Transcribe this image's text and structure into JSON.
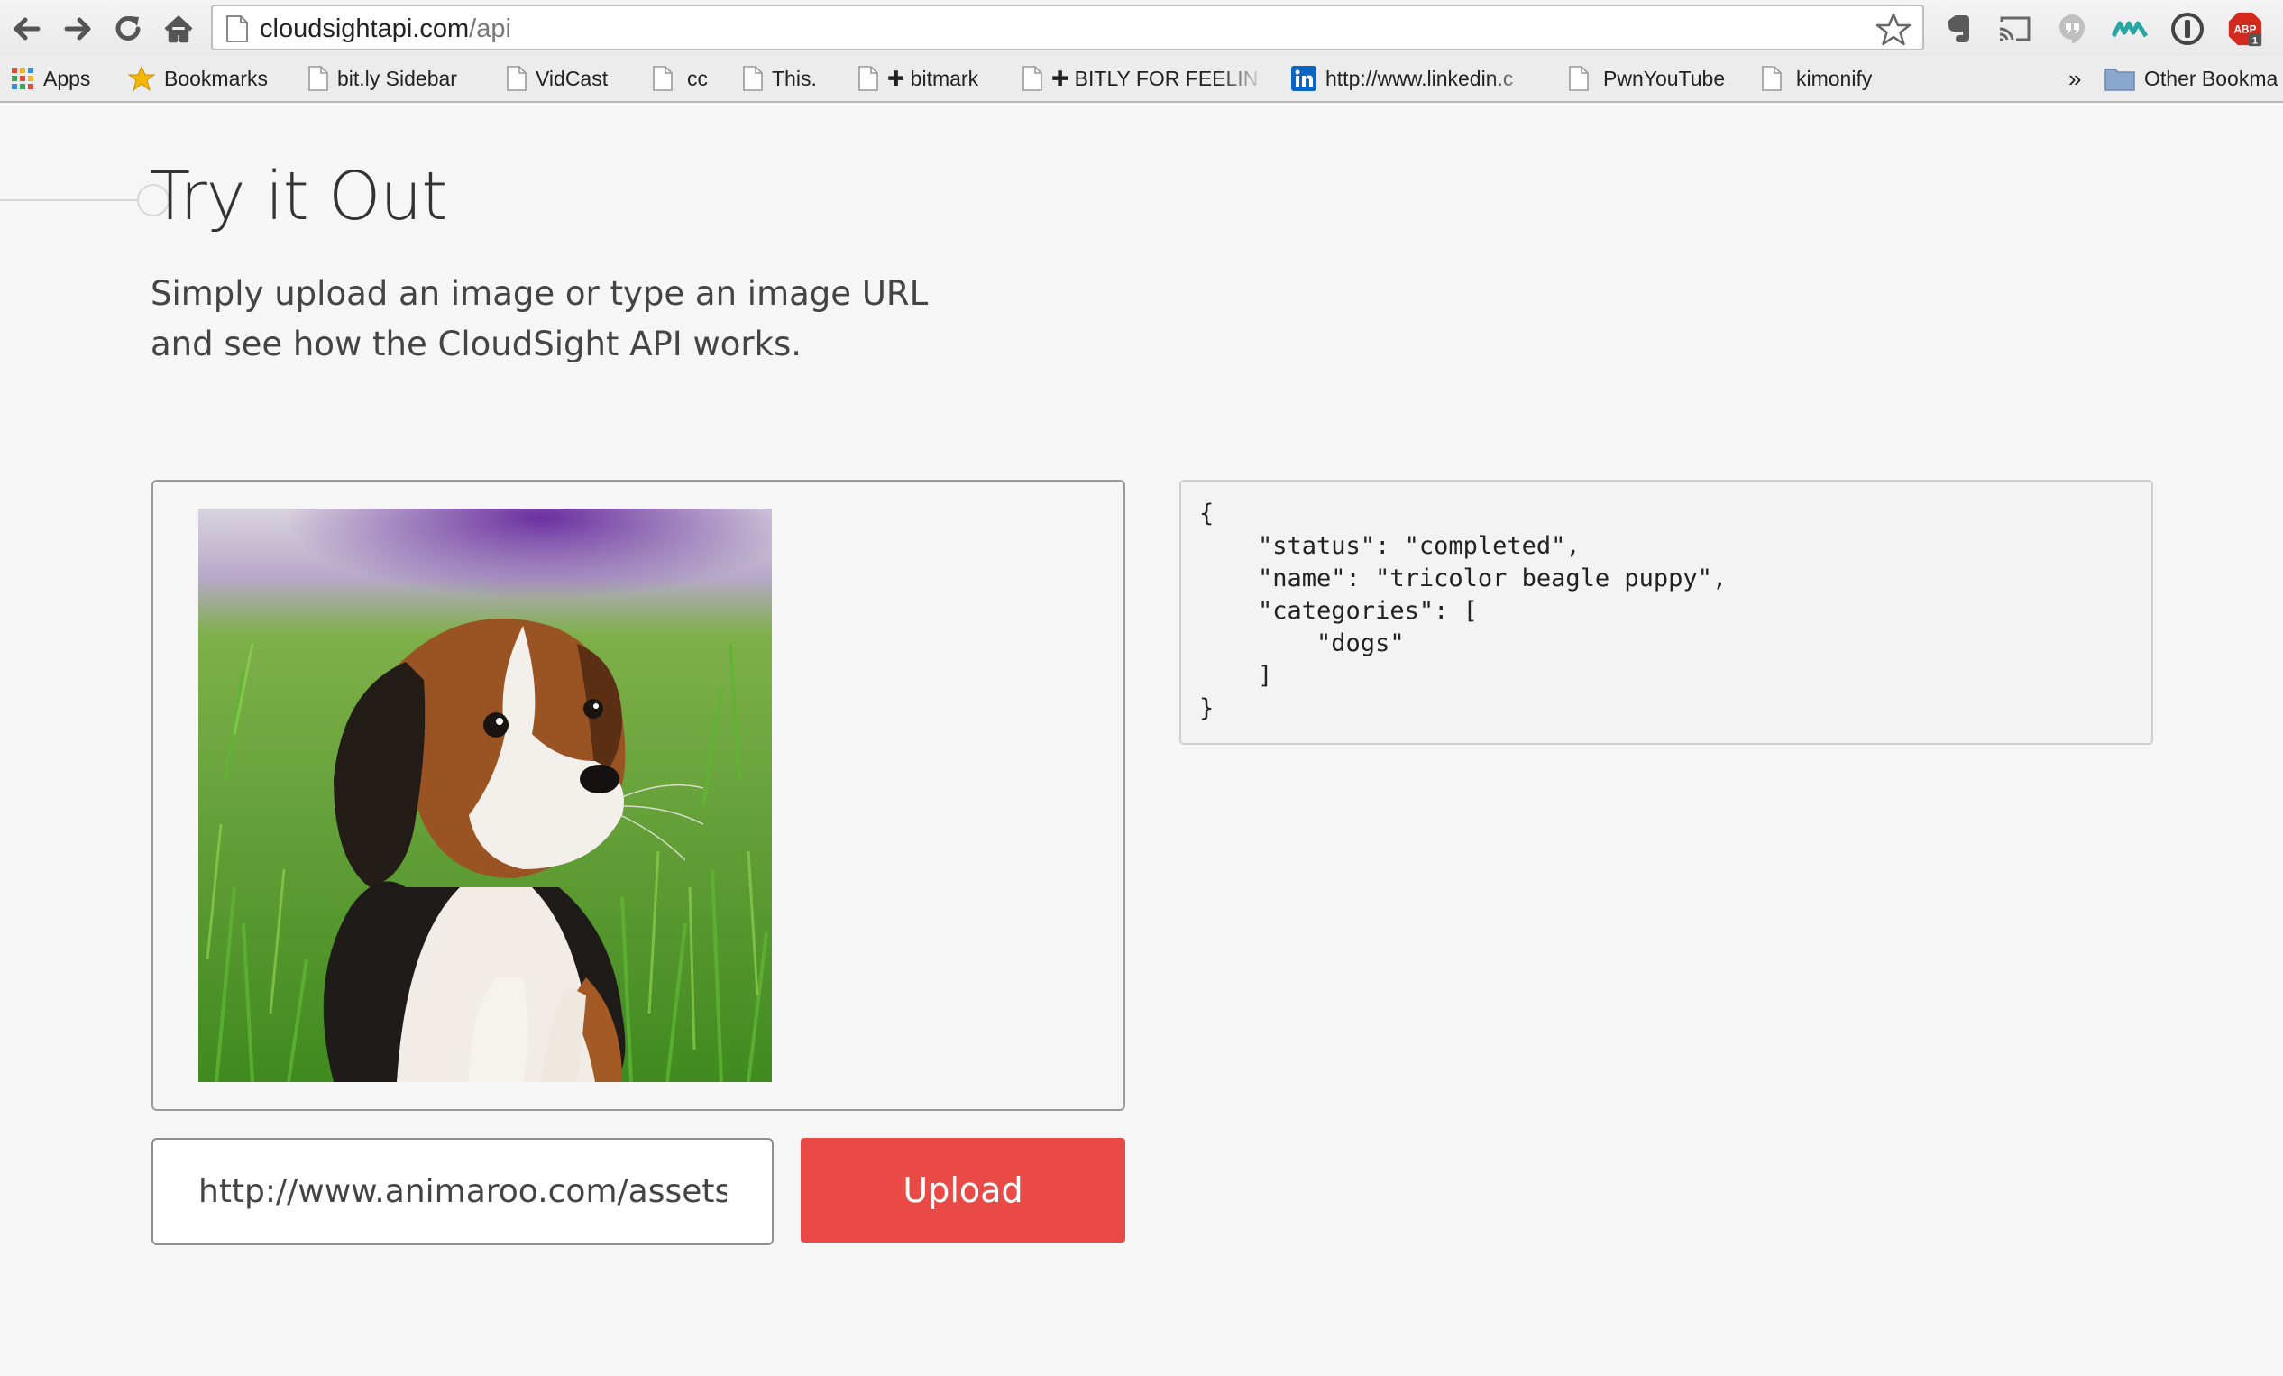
{
  "browser": {
    "url_host": "cloudsightapi.com",
    "url_path": "/api",
    "nav_icons": [
      "back-arrow-icon",
      "forward-arrow-icon",
      "reload-icon",
      "home-icon"
    ],
    "extension_icons": [
      "evernote-icon",
      "cast-icon",
      "hangouts-icon",
      "mixmax-icon",
      "1password-icon",
      "adblock-plus-icon"
    ],
    "adblock": {
      "label": "ABP",
      "badge": "1"
    }
  },
  "bookmarks": {
    "items": [
      {
        "label": "Apps",
        "icon": "apps-grid-icon"
      },
      {
        "label": "Bookmarks",
        "icon": "star-icon"
      },
      {
        "label": "bit.ly Sidebar",
        "icon": "page-icon"
      },
      {
        "label": "VidCast",
        "icon": "page-icon"
      },
      {
        "label": "cc",
        "icon": "page-icon"
      },
      {
        "label": "This.",
        "icon": "page-icon"
      },
      {
        "label": "✚ bitmark",
        "icon": "page-icon"
      },
      {
        "label": "✚ BITLY FOR FEELIN",
        "icon": "page-icon"
      },
      {
        "label": "http://www.linkedin.c",
        "icon": "linkedin-icon"
      },
      {
        "label": "PwnYouTube",
        "icon": "page-icon"
      },
      {
        "label": "kimonify",
        "icon": "page-icon"
      }
    ],
    "overflow_label": "»",
    "other_label": "Other Bookma"
  },
  "page": {
    "title": "Try it Out",
    "description": "Simply upload an image or type an image URL and see how the CloudSight API works."
  },
  "result_json": "{\n    \"status\": \"completed\",\n    \"name\": \"tricolor beagle puppy\",\n    \"categories\": [\n        \"dogs\"\n    ]\n}",
  "form": {
    "url_value": "http://www.animaroo.com/assets/sit",
    "upload_label": "Upload"
  },
  "colors": {
    "accent": "#ea4a46",
    "background": "#f6f6f6"
  }
}
